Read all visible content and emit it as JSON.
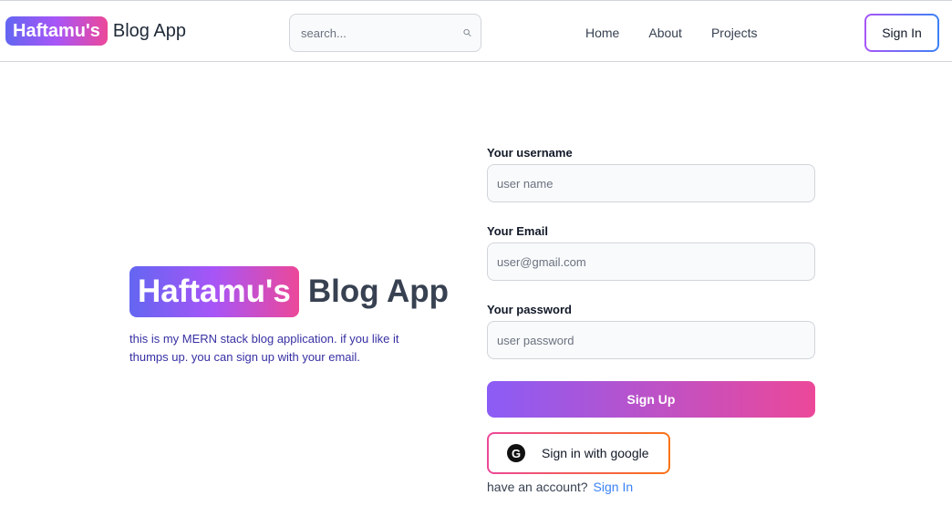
{
  "header": {
    "brand_badge": "Haftamu's",
    "brand_text": "Blog App",
    "search_placeholder": "search...",
    "nav": [
      "Home",
      "About",
      "Projects"
    ],
    "signin_label": "Sign In"
  },
  "hero": {
    "brand_badge": "Haftamu's",
    "brand_text": "Blog App",
    "description": "this is my MERN stack blog application. if you like it thumps up. you can sign up with your email."
  },
  "form": {
    "username_label": "Your username",
    "username_placeholder": "user name",
    "email_label": "Your Email",
    "email_placeholder": "user@gmail.com",
    "password_label": "Your password",
    "password_placeholder": "user password",
    "signup_label": "Sign Up",
    "google_label": "Sign in with google",
    "google_icon_glyph": "G",
    "have_account_text": "have an account?",
    "signin_link": "Sign In"
  },
  "colors": {
    "gradient_start": "#6366f1",
    "gradient_mid": "#a855f7",
    "gradient_end": "#ec4899",
    "link": "#3b82f6"
  },
  "icons": {
    "search": "search-icon",
    "google": "google-icon"
  }
}
